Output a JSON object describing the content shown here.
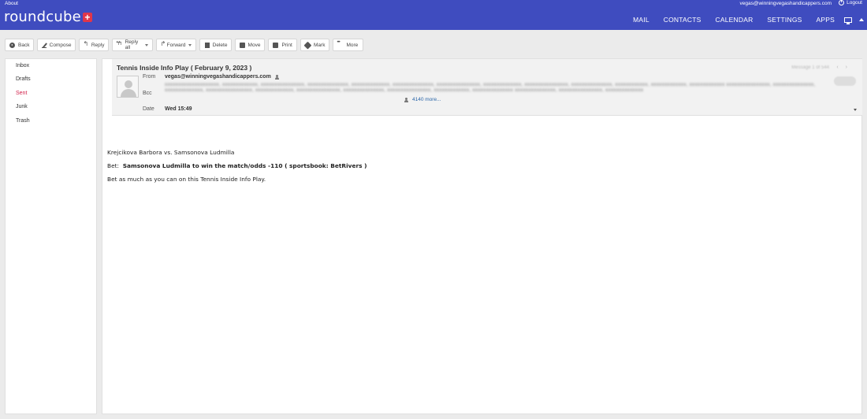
{
  "topbar": {
    "about": "About",
    "user": "vegas@winningvegashandicappers.com",
    "logout": "Logout",
    "logo": "roundcube",
    "logo_plus": "+",
    "nav": [
      "MAIL",
      "CONTACTS",
      "CALENDAR",
      "SETTINGS",
      "APPS"
    ]
  },
  "toolbar": {
    "back": "Back",
    "compose": "Compose",
    "reply": "Reply",
    "reply_all": "Reply all",
    "forward": "Forward",
    "delete": "Delete",
    "move": "Move",
    "print": "Print",
    "mark": "Mark",
    "more": "More"
  },
  "folders": [
    "Inbox",
    "Drafts",
    "Sent",
    "Junk",
    "Trash"
  ],
  "active_folder": "Sent",
  "message": {
    "subject": "Tennis Inside Info Play ( February 9, 2023 )",
    "from_label": "From",
    "from": "vegas@winningvegashandicappers.com",
    "bcc_label": "Bcc",
    "bcc_more": "4140 more...",
    "date_label": "Date",
    "date": "Wed 15:49",
    "body": {
      "line1": "Krejcikova Barbora vs. Samsonova Ludmilla",
      "bet_label": "Bet:",
      "bet": "Samsonova Ludmilla to win the match/odds -110 ( sportsbook: BetRivers )",
      "line3": "Bet as much as you can on this Tennis Inside Info Play."
    }
  },
  "colors": {
    "header_bg": "#3f4cbf",
    "active_folder": "#d2224b",
    "link": "#2a65a8"
  }
}
